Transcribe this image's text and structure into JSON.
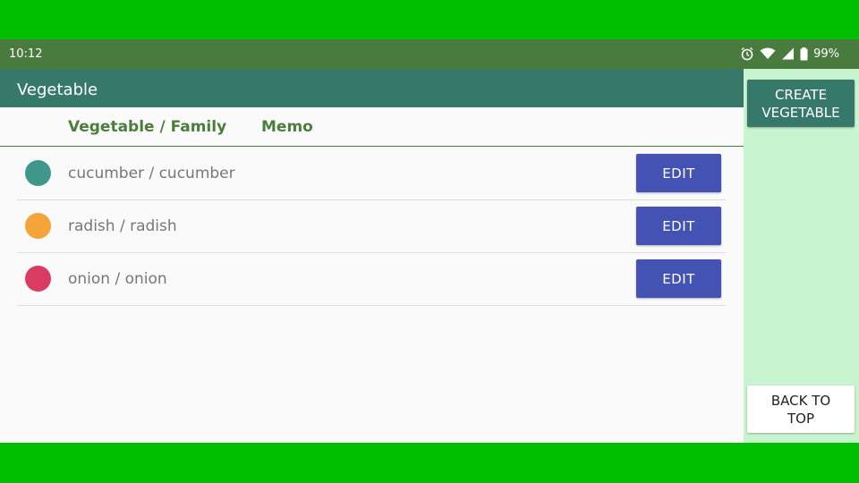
{
  "status_bar": {
    "time": "10:12",
    "battery": "99%",
    "icons": [
      "alarm-icon",
      "wifi-icon",
      "signal-icon",
      "battery-icon"
    ]
  },
  "app_bar": {
    "title": "Vegetable"
  },
  "table": {
    "headers": [
      "Vegetable / Family",
      "Memo"
    ],
    "rows": [
      {
        "label": "cucumber / cucumber",
        "color": "#3f978c",
        "edit": "EDIT"
      },
      {
        "label": "radish / radish",
        "color": "#f4a43a",
        "edit": "EDIT"
      },
      {
        "label": "onion / onion",
        "color": "#d93c63",
        "edit": "EDIT"
      }
    ]
  },
  "side": {
    "create_label": "CREATE VEGETABLE",
    "back_label": "BACK TO TOP"
  },
  "colors": {
    "accent_green": "#36786a",
    "header_text": "#4b7e3d",
    "edit_button": "#4452b3",
    "side_panel": "#c8f4cf"
  }
}
